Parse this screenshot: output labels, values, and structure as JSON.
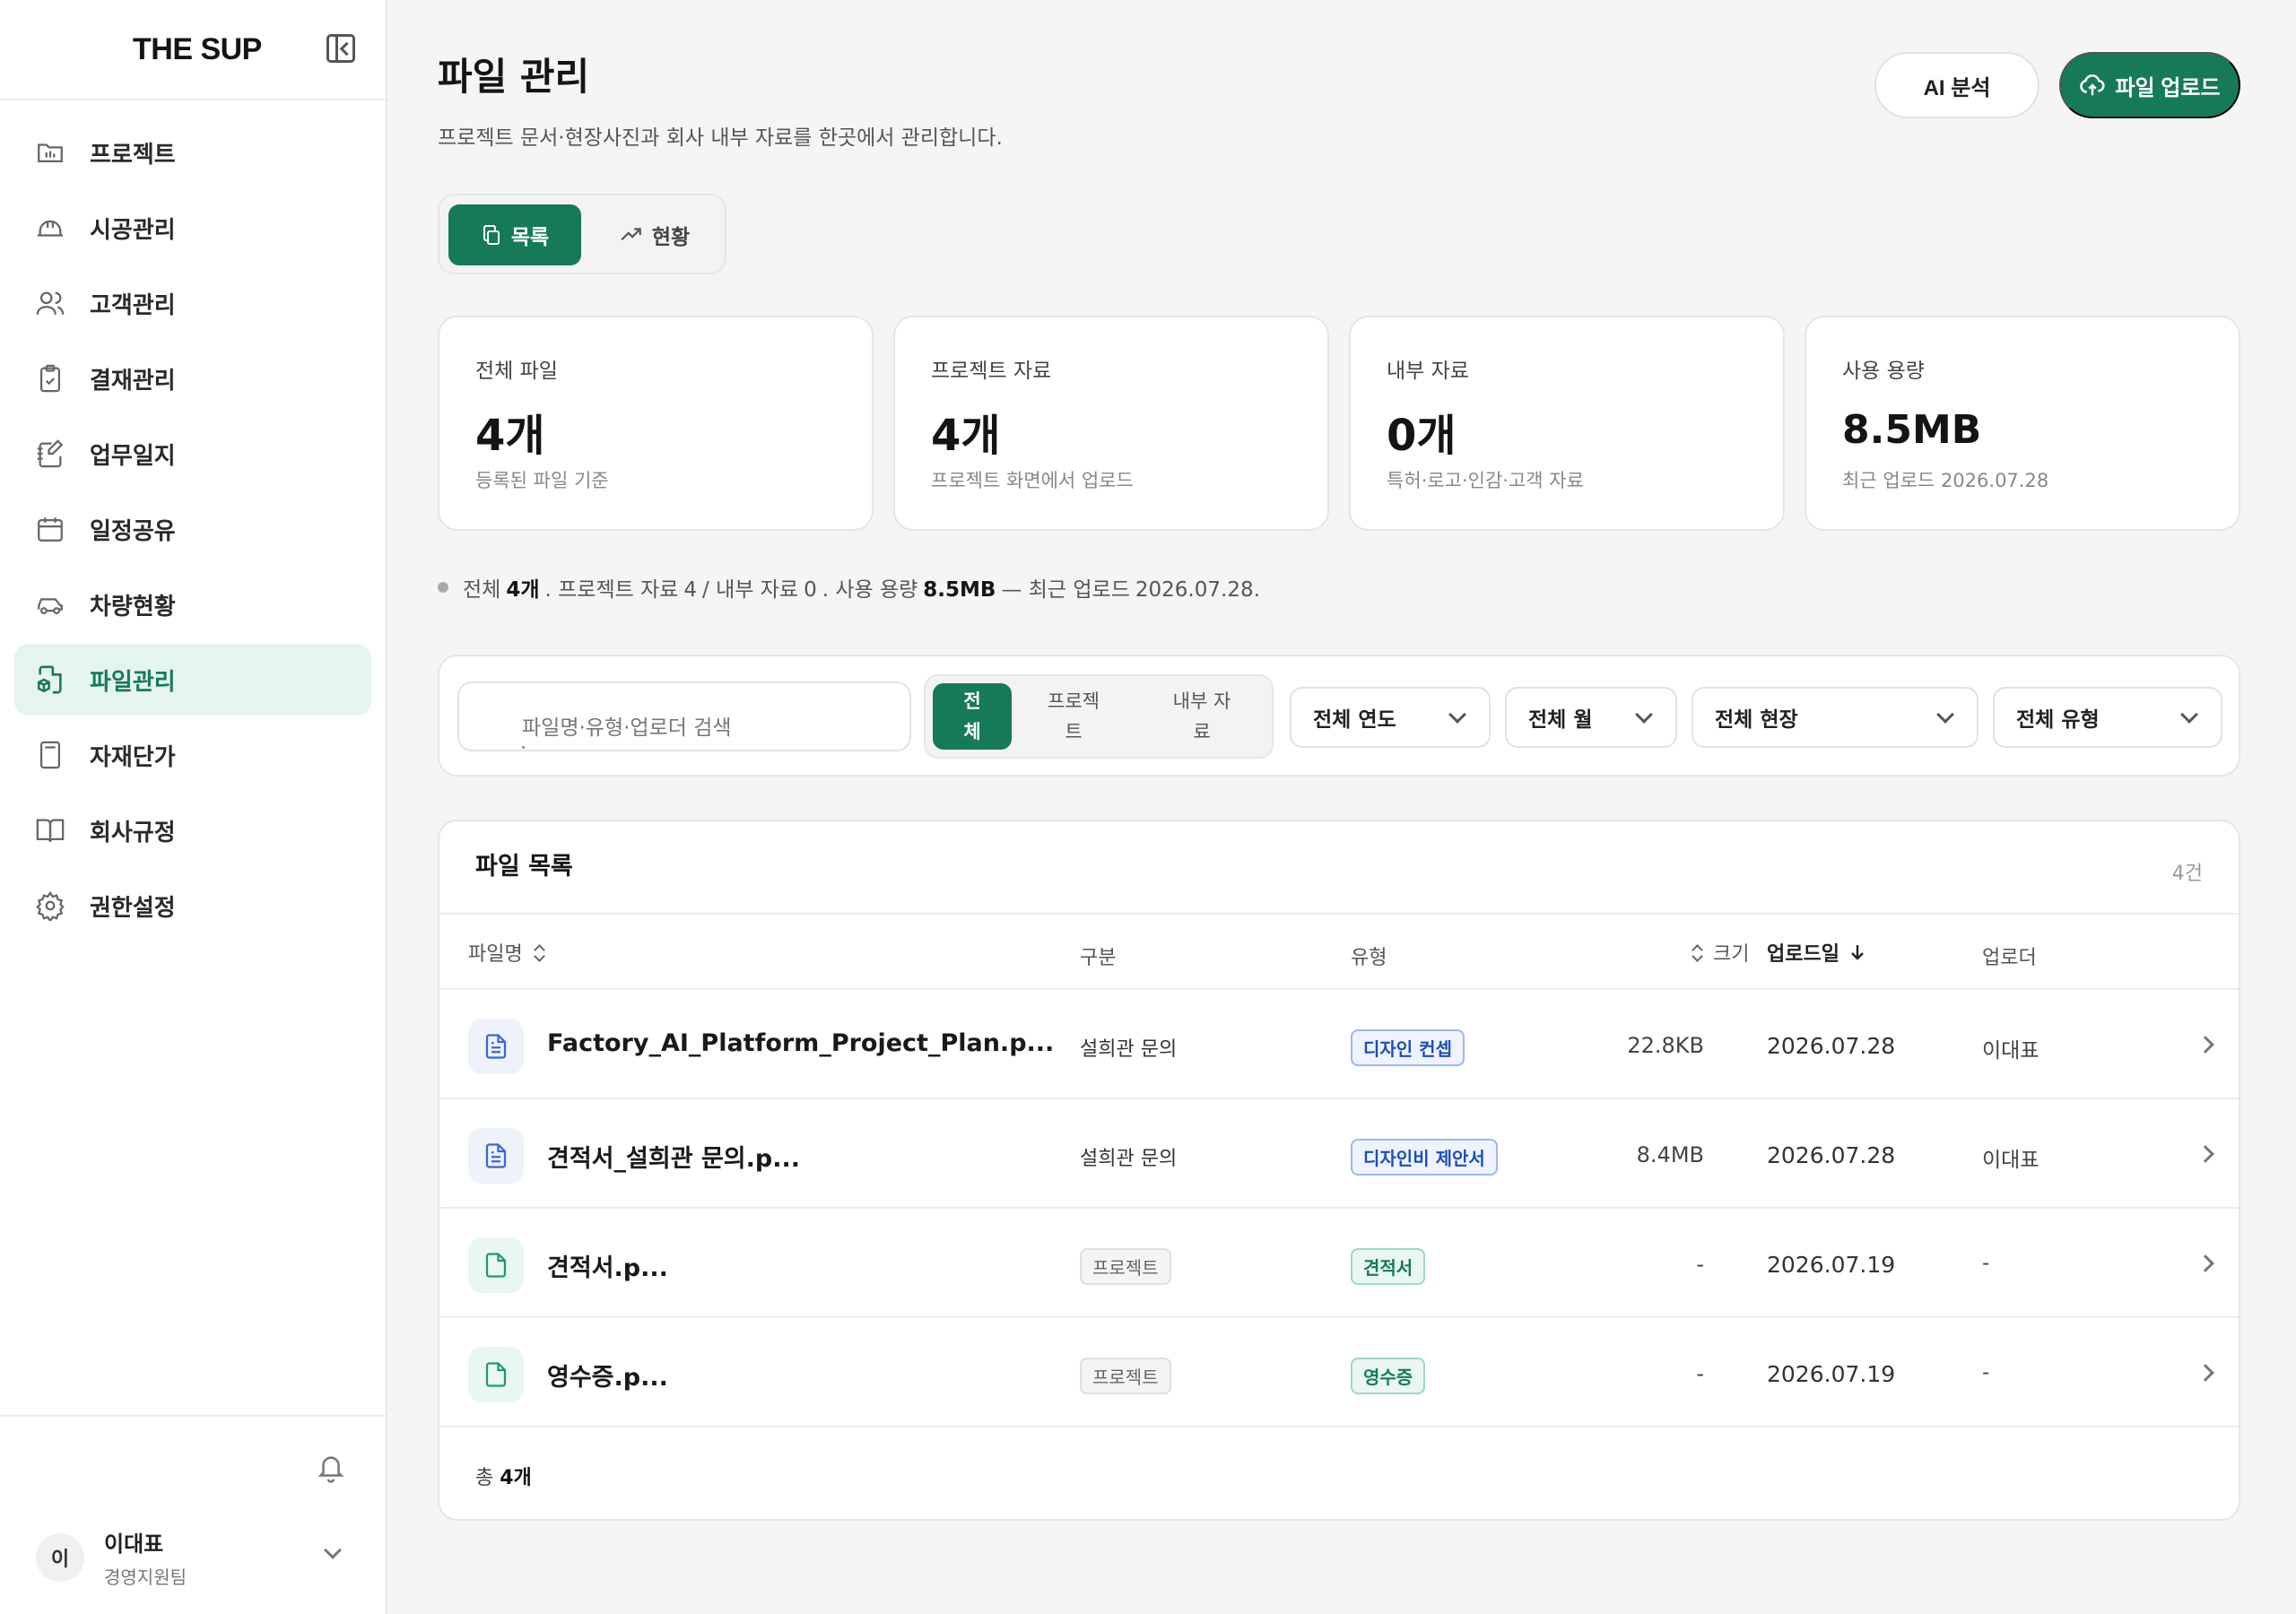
{
  "app": {
    "logo": "THE SUP"
  },
  "sidebar": {
    "items": [
      {
        "label": "프로젝트",
        "icon": "folder-icon"
      },
      {
        "label": "시공관리",
        "icon": "hardhat-icon"
      },
      {
        "label": "고객관리",
        "icon": "users-icon"
      },
      {
        "label": "결재관리",
        "icon": "clipboard-check-icon"
      },
      {
        "label": "업무일지",
        "icon": "notebook-pen-icon"
      },
      {
        "label": "일정공유",
        "icon": "calendar-icon"
      },
      {
        "label": "차량현황",
        "icon": "car-icon"
      },
      {
        "label": "파일관리",
        "icon": "file-box-icon",
        "active": true
      },
      {
        "label": "자재단가",
        "icon": "calculator-icon"
      },
      {
        "label": "회사규정",
        "icon": "book-open-icon"
      },
      {
        "label": "권한설정",
        "icon": "gear-icon"
      }
    ],
    "user": {
      "avatar": "이",
      "name": "이대표",
      "team": "경영지원팀"
    }
  },
  "header": {
    "title": "파일 관리",
    "subtitle": "프로젝트 문서·현장사진과 회사 내부 자료를 한곳에서 관리합니다.",
    "ai_button": "AI 분석",
    "upload_button": "파일 업로드"
  },
  "view_tabs": {
    "list": "목록",
    "status": "현황"
  },
  "stats": [
    {
      "title": "전체 파일",
      "value": "4개",
      "sub": "등록된 파일 기준"
    },
    {
      "title": "프로젝트 자료",
      "value": "4개",
      "sub": "프로젝트 화면에서 업로드"
    },
    {
      "title": "내부 자료",
      "value": "0개",
      "sub": "특허·로고·인감·고객 자료"
    },
    {
      "title": "사용 용량",
      "value": "8.5MB",
      "sub": "최근 업로드 2026.07.28"
    }
  ],
  "summary": {
    "p1": "전체",
    "total": "4개",
    "p2": ". 프로젝트 자료",
    "project": "4",
    "p3": "/ 내부 자료",
    "internal": "0",
    "p4": ". 사용 용량",
    "usage": "8.5MB",
    "p5": "— 최근 업로드",
    "recent": "2026.07.28."
  },
  "filters": {
    "search_placeholder": "파일명·유형·업로더 검색",
    "kind_all_1": "전",
    "kind_all_2": "체",
    "kind_project_1": "프로젝",
    "kind_project_2": "트",
    "kind_internal_1": "내부 자",
    "kind_internal_2": "료",
    "year": "전체 연도",
    "month": "전체 월",
    "site": "전체 현장",
    "type": "전체 유형"
  },
  "table": {
    "title": "파일 목록",
    "count": "4건",
    "headers": {
      "name": "파일명",
      "category": "구분",
      "type": "유형",
      "size": "크기",
      "date": "업로드일",
      "uploader": "업로더"
    },
    "rows": [
      {
        "name": "Factory_AI_Platform_Project_Plan.p...",
        "category": "설희관 문의",
        "type": "디자인 컨셉",
        "size": "22.8KB",
        "date": "2026.07.28",
        "uploader": "이대표"
      },
      {
        "name": "견적서_설희관 문의.p...",
        "category": "설희관 문의",
        "type": "디자인비 제안서",
        "size": "8.4MB",
        "date": "2026.07.28",
        "uploader": "이대표"
      },
      {
        "name": "견적서.p...",
        "category": "프로젝트",
        "type": "견적서",
        "size": "-",
        "date": "2026.07.19",
        "uploader": "-"
      },
      {
        "name": "영수증.p...",
        "category": "프로젝트",
        "type": "영수증",
        "size": "-",
        "date": "2026.07.19",
        "uploader": "-"
      }
    ],
    "footer_label": "총",
    "footer_count": "4개"
  },
  "colors": {
    "accent": "#177a57",
    "accent_light": "#e6f4ee",
    "tag_blue": "#1d4fb3"
  }
}
